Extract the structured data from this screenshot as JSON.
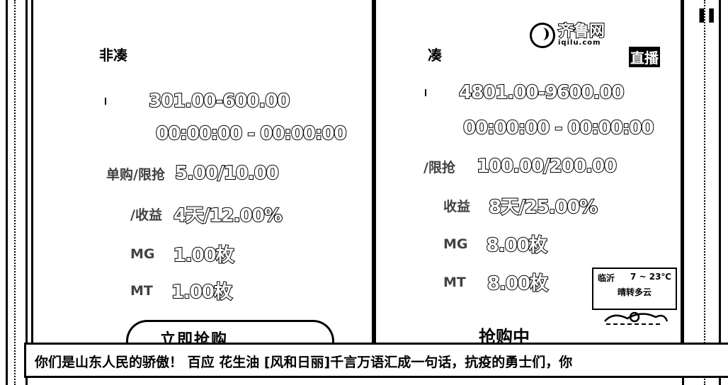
{
  "logo": {
    "name": "齐鲁网",
    "domain": "iqilu.com"
  },
  "live_badge": "直播",
  "left_card": {
    "title": "非凑",
    "rows": [
      {
        "label": "",
        "value": "301.00-600.00"
      },
      {
        "label": "",
        "value": "00:00:00 - 00:00:00"
      },
      {
        "label": "单购/限抢",
        "value": "5.00/10.00"
      },
      {
        "label": "/收益",
        "value": "4天/12.00%"
      },
      {
        "label": "MG",
        "value": "1.00枚"
      },
      {
        "label": "MT",
        "value": "1.00枚"
      }
    ],
    "tab_label": "立即抢购"
  },
  "right_card": {
    "title": "凑",
    "rows": [
      {
        "label": "",
        "value": "4801.00-9600.00"
      },
      {
        "label": "",
        "value": "00:00:00 - 00:00:00"
      },
      {
        "label": "/限抢",
        "value": "100.00/200.00"
      },
      {
        "label": "收益",
        "value": "8天/25.00%"
      },
      {
        "label": "MG",
        "value": "8.00枚"
      },
      {
        "label": "MT",
        "value": "8.00枚"
      }
    ],
    "tab_label": "抢购中"
  },
  "weather": {
    "city": "临沂",
    "temp": "7 ~ 23℃",
    "desc": "晴转多云"
  },
  "ticker": {
    "text": "你们是山东人民的骄傲！ 百应 花生油 [风和日丽]千言万语汇成一句话，抗疫的勇士们，你"
  },
  "icons": {
    "pause": "pause-icon",
    "logo": "qilu-logo-icon",
    "weather": "sun-cloud-icon"
  }
}
